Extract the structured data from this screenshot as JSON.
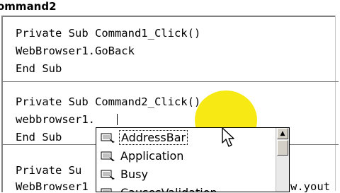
{
  "window": {
    "title": "ommand2"
  },
  "code": {
    "lines": [
      "Private Sub Command1_Click()",
      "WebBrowser1.GoBack",
      "End Sub",
      "Private Sub Command2_Click()",
      "webbrowser1.",
      "End Sub",
      "Private Su",
      "WebBrowser1",
      "w.yout"
    ]
  },
  "autocomplete": {
    "items": [
      "AddressBar",
      "Application",
      "Busy",
      "CausesValidation"
    ],
    "selected": "AddressBar",
    "scroll_up_glyph": "▲",
    "item_icon": "property-icon"
  },
  "colors": {
    "highlight": "#f6e800",
    "separator": "#7a7a7a"
  }
}
